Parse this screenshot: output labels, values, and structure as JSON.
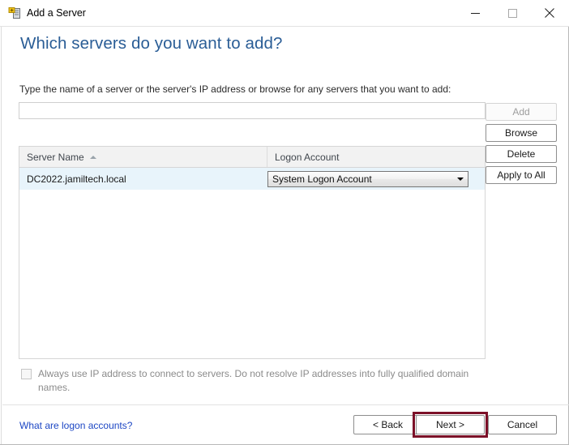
{
  "window": {
    "title": "Add a Server",
    "icon": "add-server-icon",
    "controls": {
      "minimize": "minimize-icon",
      "maximize": "maximize-icon",
      "close": "close-icon"
    }
  },
  "page": {
    "heading": "Which servers do you want to add?",
    "instruction": "Type the name of a server or the server's IP address or browse for any servers that you want to add:"
  },
  "server_input": {
    "value": "",
    "placeholder": ""
  },
  "side_buttons": [
    {
      "label": "Add",
      "enabled": false
    },
    {
      "label": "Browse",
      "enabled": true
    },
    {
      "label": "Delete",
      "enabled": true
    },
    {
      "label": "Apply to All",
      "enabled": true
    }
  ],
  "list": {
    "columns": [
      {
        "label": "Server Name",
        "sort": "ascending"
      },
      {
        "label": "Logon Account",
        "sort": "none"
      }
    ],
    "rows": [
      {
        "server_name": "DC2022.jamiltech.local",
        "logon_account": "System Logon Account"
      }
    ]
  },
  "checkbox": {
    "label": "Always use IP address to connect to servers. Do not resolve IP addresses into fully qualified domain names.",
    "checked": false,
    "enabled": false
  },
  "footer": {
    "help_link": "What are logon accounts?",
    "back_label": "< Back",
    "next_label": "Next >",
    "cancel_label": "Cancel"
  },
  "colors": {
    "heading": "#2a5d96",
    "link": "#1d47c4",
    "row_selected": "#e8f4fb",
    "highlight_border": "#7c1028"
  }
}
